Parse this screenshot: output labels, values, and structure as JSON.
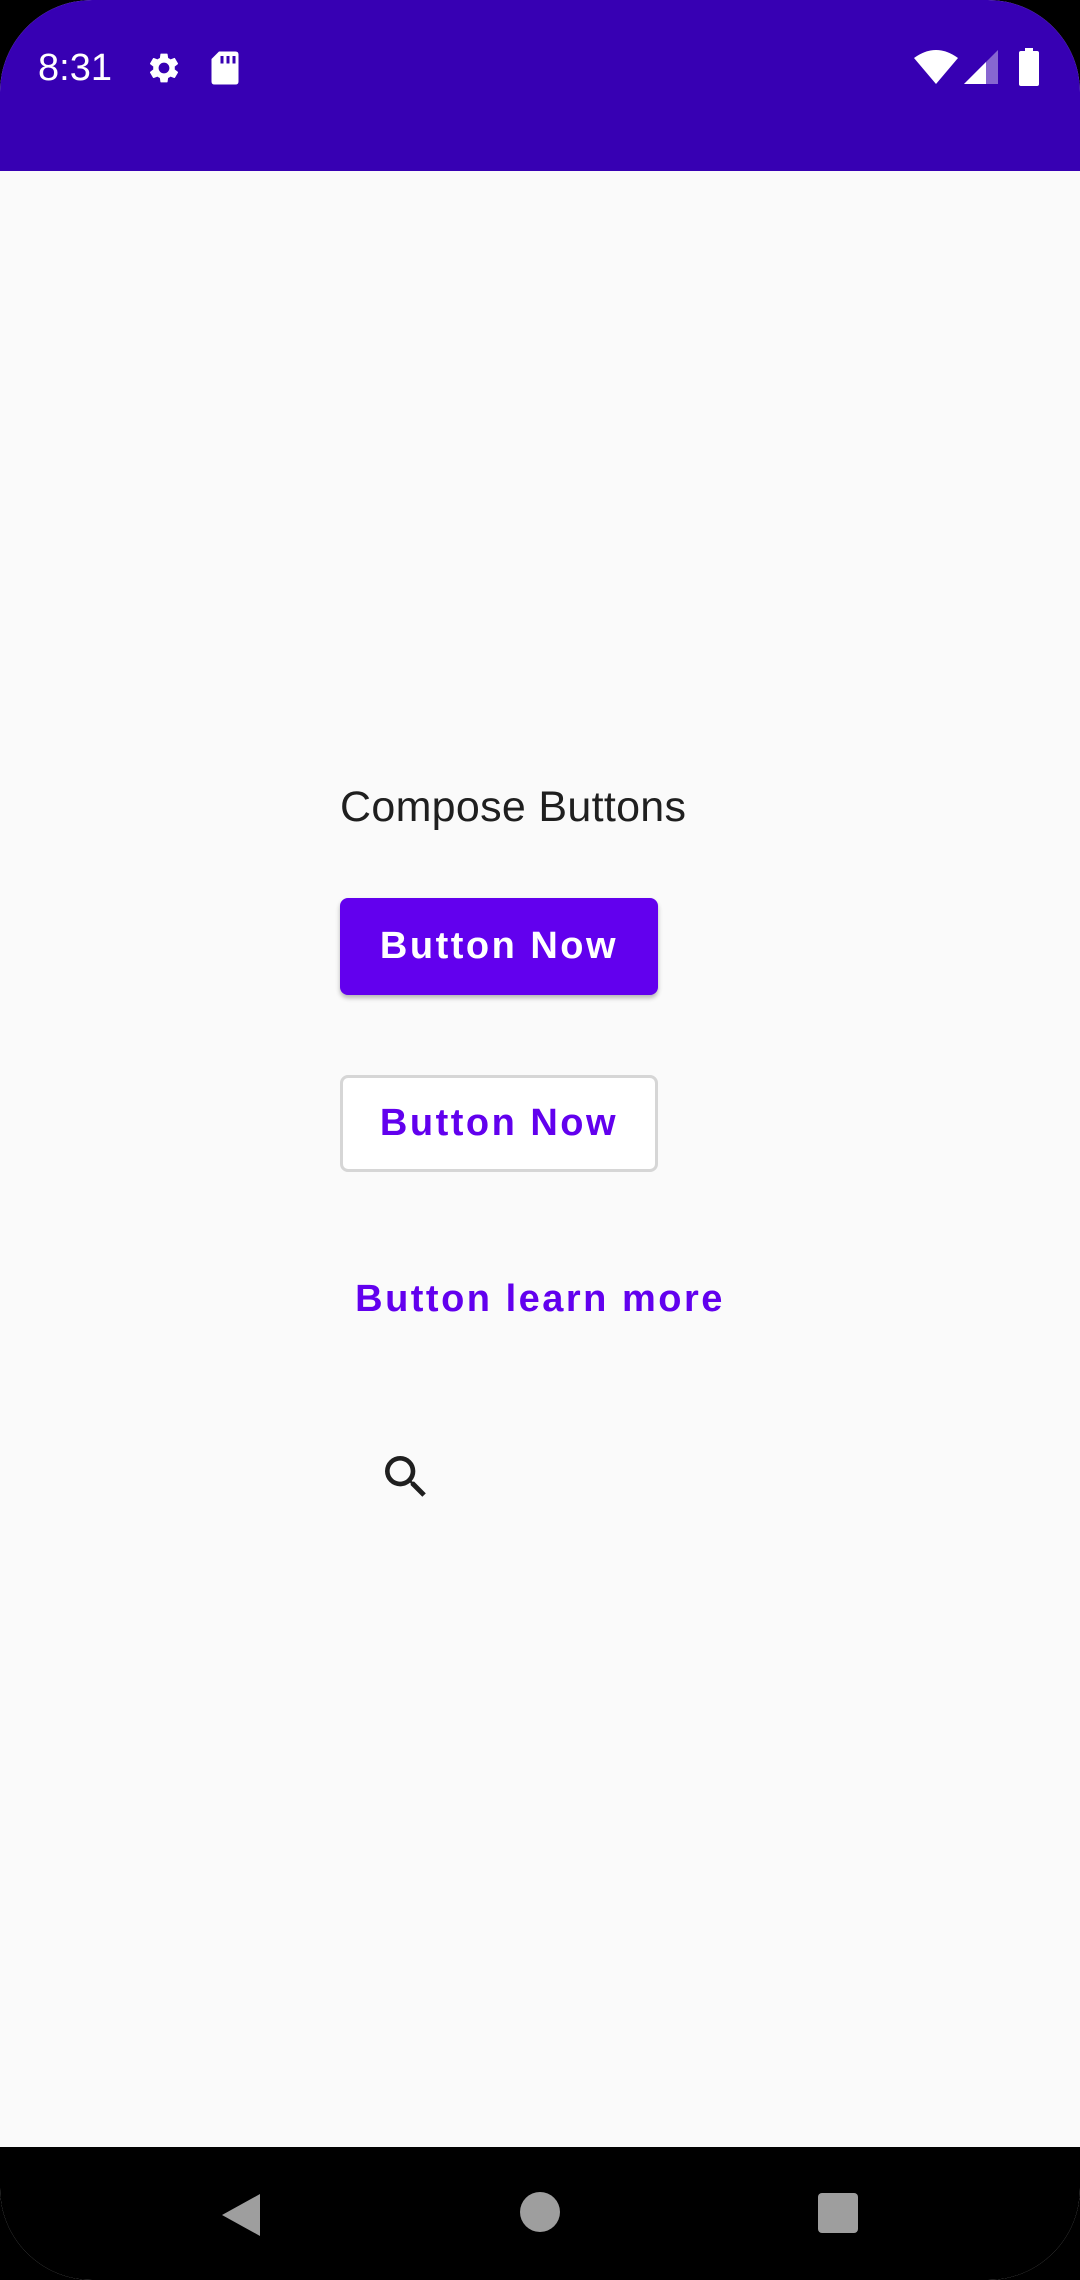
{
  "status_bar": {
    "time": "8:31",
    "background_color": "#3700b3",
    "left_icons": [
      "settings-gear-icon",
      "sd-card-icon"
    ],
    "right_icons": [
      "wifi-icon",
      "cell-signal-icon",
      "battery-icon"
    ]
  },
  "main": {
    "title": "Compose Buttons",
    "filled_button_label": "Button Now",
    "outlined_button_label": "Button Now",
    "text_button_label": "Button learn more",
    "icon_button_icon": "search-icon",
    "accent_color": "#6200ee",
    "background_color": "#fafafa"
  },
  "nav_bar": {
    "buttons": [
      "back-icon",
      "home-icon",
      "recents-icon"
    ]
  }
}
